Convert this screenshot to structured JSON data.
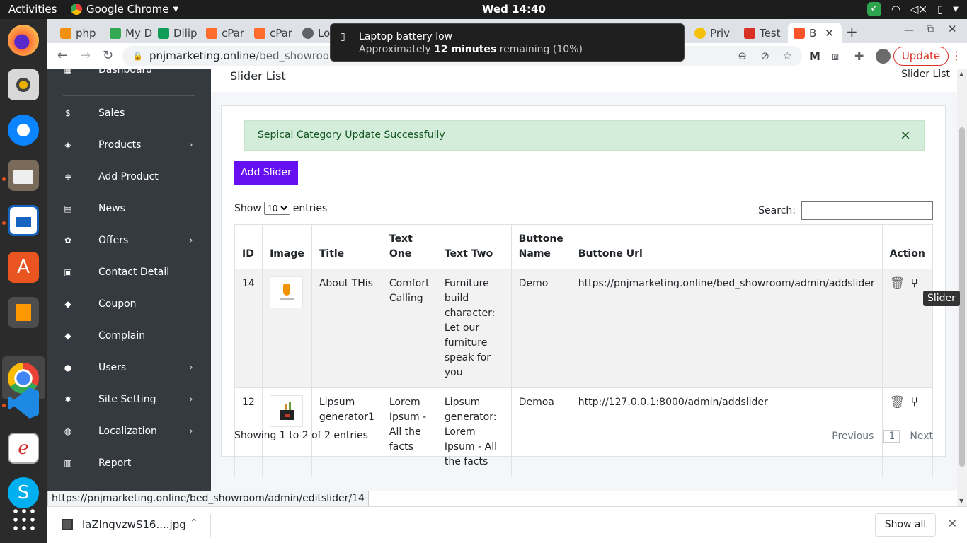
{
  "topbar": {
    "activities": "Activities",
    "app_name": "Google Chrome",
    "clock": "Wed 14:40"
  },
  "tabs": [
    {
      "label": "php",
      "color": "#f29111"
    },
    {
      "label": "My D",
      "color": "#34a853"
    },
    {
      "label": "Dilip",
      "color": "#0f9d58"
    },
    {
      "label": "cPar",
      "color": "#ff6c2c"
    },
    {
      "label": "cPar",
      "color": "#ff6c2c"
    },
    {
      "label": "Lo",
      "color": "#5f6368"
    },
    {
      "label": "Priv",
      "color": "#f4c20d"
    },
    {
      "label": "Test",
      "color": "#d93025"
    },
    {
      "label": "B",
      "color": "#fb542b"
    }
  ],
  "address": {
    "domain": "pnjmarketing.online",
    "path": "/bed_showroom/adm",
    "update_label": "Update"
  },
  "notification": {
    "title": "Laptop battery low",
    "prefix": "Approximately",
    "bold": "12 minutes",
    "suffix": "remaining (10%)"
  },
  "sidebar": {
    "partial_item": "Dashboard",
    "items": [
      {
        "label": "Sales",
        "icon": "dollar-icon",
        "glyph": "$",
        "arrow": ""
      },
      {
        "label": "Products",
        "icon": "cube-icon",
        "glyph": "◈",
        "arrow": "›"
      },
      {
        "label": "Add Product",
        "icon": "add-product-icon",
        "glyph": "≑",
        "arrow": ""
      },
      {
        "label": "News",
        "icon": "news-icon",
        "glyph": "▤",
        "arrow": ""
      },
      {
        "label": "Offers",
        "icon": "gift-icon",
        "glyph": "✿",
        "arrow": "›"
      },
      {
        "label": "Contact Detail",
        "icon": "contact-icon",
        "glyph": "▣",
        "arrow": ""
      },
      {
        "label": "Coupon",
        "icon": "tag-icon",
        "glyph": "◆",
        "arrow": ""
      },
      {
        "label": "Complain",
        "icon": "tag-icon",
        "glyph": "◆",
        "arrow": ""
      },
      {
        "label": "Users",
        "icon": "users-icon",
        "glyph": "●",
        "arrow": "›"
      },
      {
        "label": "Site Setting",
        "icon": "gear-icon",
        "glyph": "✹",
        "arrow": "›"
      },
      {
        "label": "Localization",
        "icon": "globe-icon",
        "glyph": "◍",
        "arrow": "›"
      },
      {
        "label": "Report",
        "icon": "bar-chart-icon",
        "glyph": "▥",
        "arrow": ""
      }
    ]
  },
  "page": {
    "title": "Slider List",
    "breadcrumb": "Slider List",
    "alert": "Sepical Category Update Successfully",
    "alert_close": "×",
    "add_button": "Add Slider",
    "show_label": "Show",
    "entries_value": "10",
    "entries_label": "entries",
    "search_label": "Search:",
    "columns": [
      "ID",
      "Image",
      "Title",
      "Text One",
      "Text Two",
      "Buttone Name",
      "Buttone Url",
      "Action"
    ],
    "rows": [
      {
        "id": "14",
        "title": "About THis",
        "text_one": "Comfort Calling",
        "text_two": "Furniture build character: Let our furniture speak for you",
        "button_name": "Demo",
        "button_url": "https://pnjmarketing.online/bed_showroom/admin/addslider"
      },
      {
        "id": "12",
        "title": "Lipsum generator1",
        "text_one": "Lorem Ipsum - All the facts",
        "text_two": "Lipsum generator: Lorem Ipsum - All the facts",
        "button_name": "Demoa",
        "button_url": "http://127.0.0.1:8000/admin/addslider"
      }
    ],
    "info": "Showing 1 to 2 of 2 entries",
    "prev": "Previous",
    "page_num": "1",
    "next": "Next"
  },
  "tooltip": "Slider",
  "status_url": "https://pnjmarketing.online/bed_showroom/admin/editslider/14",
  "download": {
    "filename": "laZlngvzwS16....jpg",
    "show_all": "Show all"
  },
  "colors": {
    "accent": "#6610f2",
    "sidebar": "#343a40",
    "alert_bg": "#d4edda",
    "alert_text": "#155724"
  }
}
